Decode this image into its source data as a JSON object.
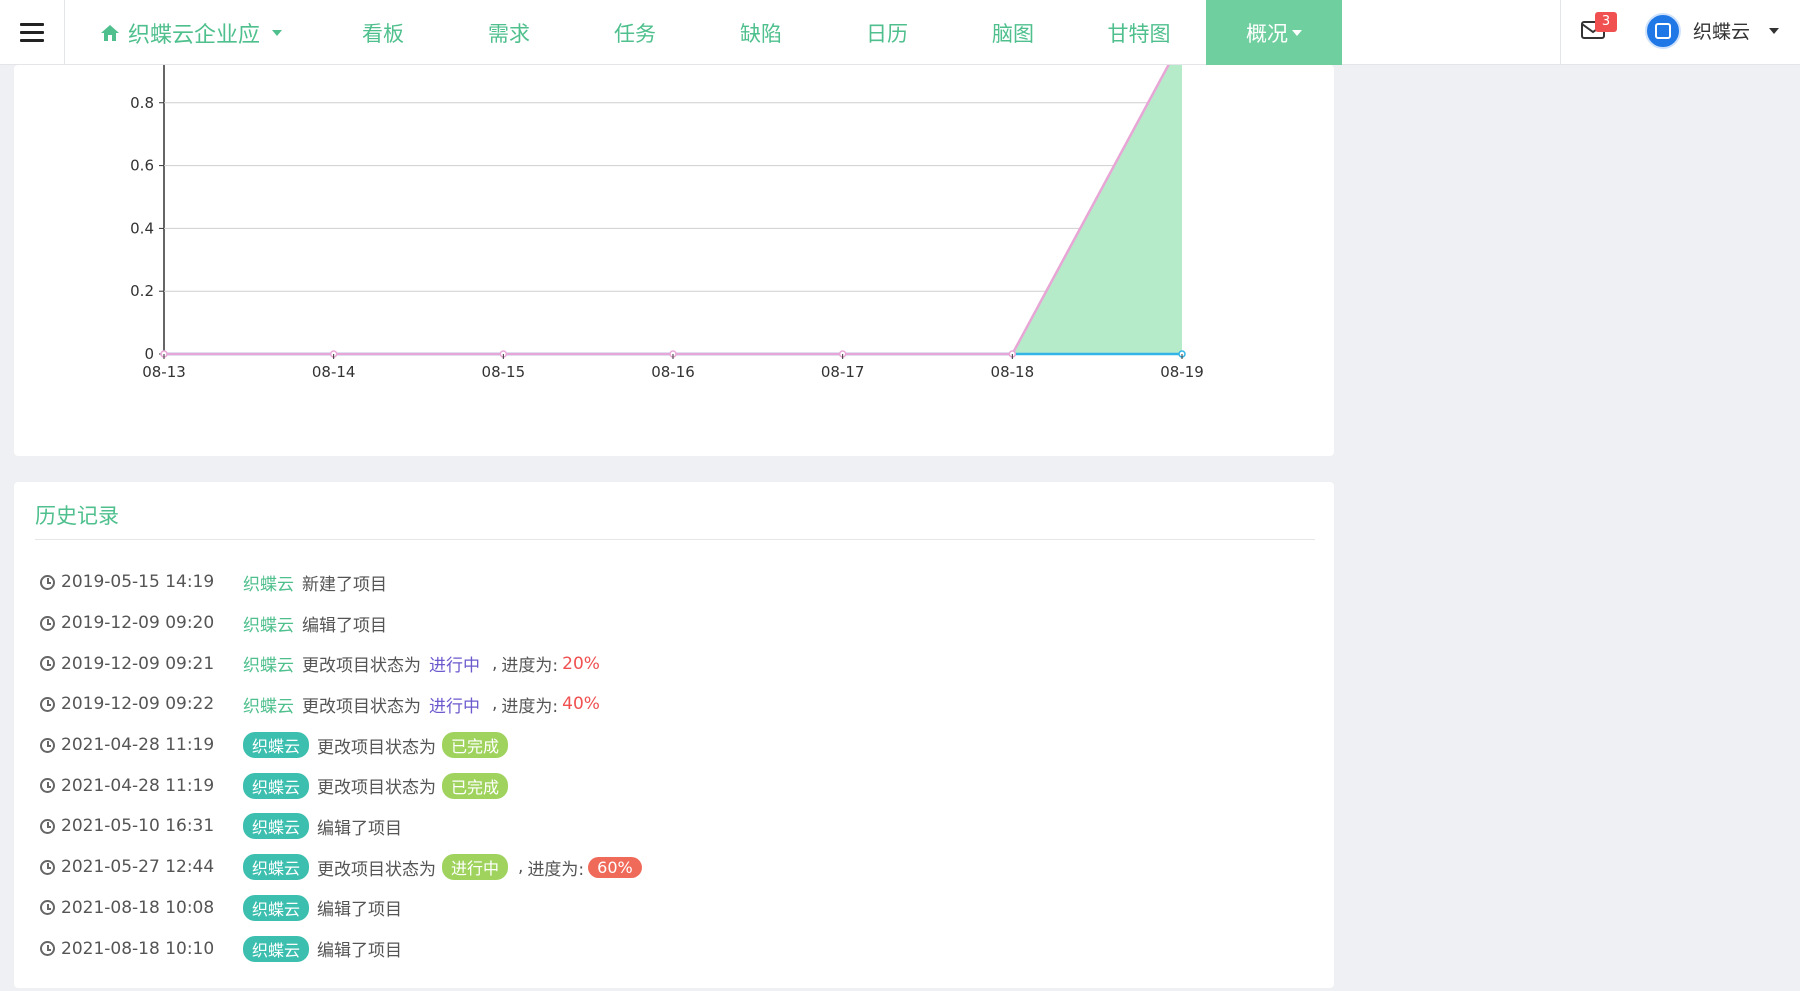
{
  "nav": {
    "project_name": "织蝶云企业应",
    "tabs": [
      {
        "label": "看板"
      },
      {
        "label": "需求"
      },
      {
        "label": "任务"
      },
      {
        "label": "缺陷"
      },
      {
        "label": "日历"
      },
      {
        "label": "脑图"
      },
      {
        "label": "甘特图"
      }
    ],
    "active_tab": {
      "label": "概况"
    },
    "mail_count": "3",
    "user_name": "织蝶云",
    "accent_color": "#4fc08d",
    "active_color": "#6fcf9f"
  },
  "chart_data": {
    "type": "area",
    "x": [
      "08-13",
      "08-14",
      "08-15",
      "08-16",
      "08-17",
      "08-18",
      "08-19"
    ],
    "y_ticks": [
      "0",
      "0.2",
      "0.4",
      "0.6",
      "0.8"
    ],
    "ylim": [
      0,
      1
    ],
    "grid": true,
    "series": [
      {
        "values": [
          0,
          0,
          0,
          0,
          0,
          0,
          1
        ],
        "color": "#e8a6d6",
        "fill": "#b6ebca"
      },
      {
        "values": [
          0,
          0,
          0,
          0,
          0,
          0,
          0
        ],
        "color": "#33b4e6"
      }
    ]
  },
  "history": {
    "title": "历史记录",
    "label_progress": "进度为:",
    "items": [
      {
        "time": "2019-05-15 14:19",
        "user": "织蝶云",
        "action": "新建了项目"
      },
      {
        "time": "2019-12-09 09:20",
        "user": "织蝶云",
        "action": "编辑了项目"
      },
      {
        "time": "2019-12-09 09:21",
        "user": "织蝶云",
        "action": "更改项目状态为",
        "status": "进行中",
        "comma": ",",
        "progress_label": "进度为:",
        "progress": "20%"
      },
      {
        "time": "2019-12-09 09:22",
        "user": "织蝶云",
        "action": "更改项目状态为",
        "status": "进行中",
        "comma": ",",
        "progress_label": "进度为:",
        "progress": "40%"
      },
      {
        "time": "2021-04-28 11:19",
        "user": "织蝶云",
        "action": "更改项目状态为",
        "status": "已完成"
      },
      {
        "time": "2021-04-28 11:19",
        "user": "织蝶云",
        "action": "更改项目状态为",
        "status": "已完成"
      },
      {
        "time": "2021-05-10 16:31",
        "user": "织蝶云",
        "action": "编辑了项目"
      },
      {
        "time": "2021-05-27 12:44",
        "user": "织蝶云",
        "action": "更改项目状态为",
        "status": "进行中",
        "comma": ",",
        "progress_label": "进度为:",
        "progress": "60%"
      },
      {
        "time": "2021-08-18 10:08",
        "user": "织蝶云",
        "action": "编辑了项目"
      },
      {
        "time": "2021-08-18 10:10",
        "user": "织蝶云",
        "action": "编辑了项目"
      }
    ]
  }
}
